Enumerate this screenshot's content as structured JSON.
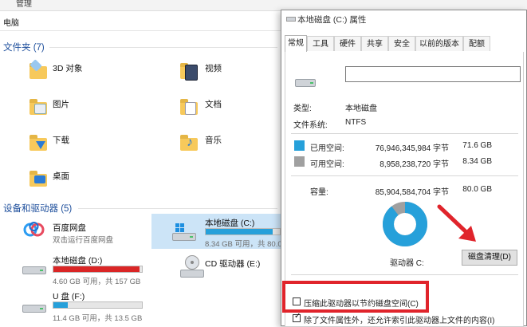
{
  "explorer": {
    "ribbon_label": "管理",
    "address_label": "电脑",
    "folders_header": "文件夹 (7)",
    "folders": [
      {
        "label": "3D 对象",
        "icon": "folder-3d-icon"
      },
      {
        "label": "视频",
        "icon": "folder-video-icon"
      },
      {
        "label": "图片",
        "icon": "folder-pictures-icon"
      },
      {
        "label": "文档",
        "icon": "folder-documents-icon"
      },
      {
        "label": "下载",
        "icon": "folder-downloads-icon"
      },
      {
        "label": "音乐",
        "icon": "folder-music-icon"
      },
      {
        "label": "桌面",
        "icon": "folder-desktop-icon"
      }
    ],
    "devices_header": "设备和驱动器 (5)",
    "devices": [
      {
        "name": "百度网盘",
        "sub": "双击运行百度网盘",
        "icon": "baidu-netdisk-icon"
      },
      {
        "name": "本地磁盘 (C:)",
        "free": "8.34 GB 可用，共 80.0",
        "used_fraction": 0.9,
        "bar_color": "#26a0da"
      },
      {
        "name": "本地磁盘 (D:)",
        "free": "4.60 GB 可用，共 157 GB",
        "used_fraction": 0.97,
        "bar_color": "#da2626"
      },
      {
        "name": "CD 驱动器 (E:)",
        "icon": "cd-drive-icon"
      },
      {
        "name": "U 盘 (F:)",
        "free": "11.4 GB 可用，共 13.5 GB",
        "used_fraction": 0.16,
        "bar_color": "#26a0da"
      }
    ]
  },
  "dialog": {
    "title": "本地磁盘 (C:) 属性",
    "tabs": [
      "常规",
      "工具",
      "硬件",
      "共享",
      "安全",
      "以前的版本",
      "配额"
    ],
    "active_tab": "常规",
    "name_value": "",
    "type_label": "类型:",
    "type_value": "本地磁盘",
    "fs_label": "文件系统:",
    "fs_value": "NTFS",
    "used": {
      "label": "已用空间:",
      "bytes": "76,946,345,984 字节",
      "size": "71.6 GB",
      "color": "#26a0da"
    },
    "free": {
      "label": "可用空间:",
      "bytes": "8,958,238,720 字节",
      "size": "8.34 GB",
      "color": "#a0a0a0"
    },
    "capacity": {
      "label": "容量:",
      "bytes": "85,904,584,704 字节",
      "size": "80.0 GB"
    },
    "used_fraction": 0.896,
    "drive_label": "驱动器 C:",
    "cleanup_button": "磁盘清理(D)",
    "compress_label": "压缩此驱动器以节约磁盘空间(C)",
    "index_label": "除了文件属性外，还允许索引此驱动器上文件的内容(I)",
    "index_checked": true,
    "compress_checked": false
  },
  "colors": {
    "accent": "#26a0da",
    "highlight": "#e0242b"
  }
}
